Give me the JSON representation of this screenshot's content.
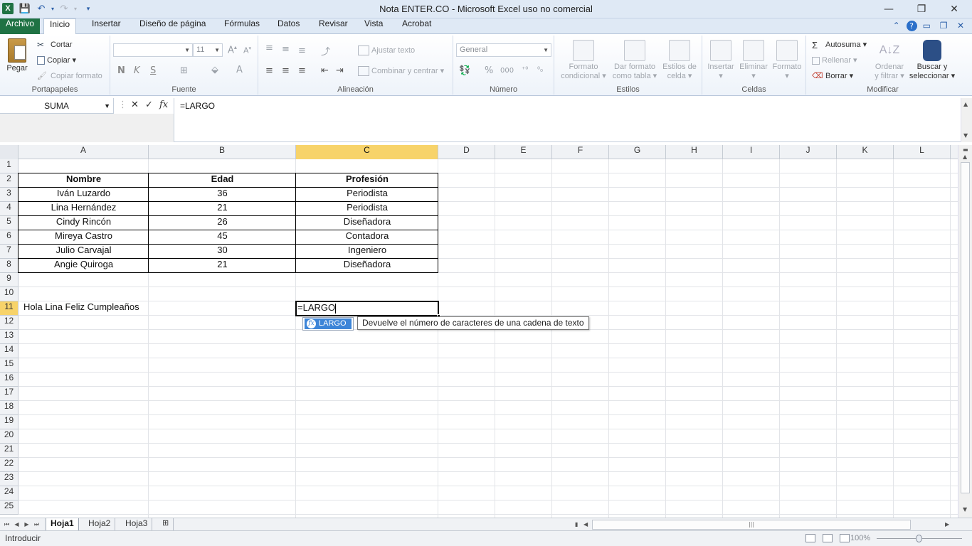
{
  "window": {
    "title": "Nota ENTER.CO  -  Microsoft Excel uso no comercial",
    "app_icon": "X",
    "minimize": "—",
    "restore": "❐",
    "close": "✕"
  },
  "qat": {
    "save": "💾",
    "undo": "↶",
    "redo": "↷",
    "customize": "▾"
  },
  "tabs": [
    "Archivo",
    "Inicio",
    "Insertar",
    "Diseño de página",
    "Fórmulas",
    "Datos",
    "Revisar",
    "Vista",
    "Acrobat"
  ],
  "ribbon": {
    "portapapeles": {
      "label": "Portapapeles",
      "pegar": "Pegar",
      "cortar": "Cortar",
      "copiar": "Copiar",
      "copiar_formato": "Copiar formato"
    },
    "fuente": {
      "label": "Fuente",
      "font_size": "11",
      "bold": "N",
      "italic": "K",
      "underline": "S"
    },
    "alineacion": {
      "label": "Alineación",
      "ajustar": "Ajustar texto",
      "combinar": "Combinar y centrar"
    },
    "numero": {
      "label": "Número",
      "format": "General",
      "percent": "%",
      "thousands": "000"
    },
    "estilos": {
      "label": "Estilos",
      "formato_condicional": [
        "Formato",
        "condicional"
      ],
      "dar_formato": [
        "Dar formato",
        "como tabla"
      ],
      "estilos_celda": [
        "Estilos de",
        "celda"
      ]
    },
    "celdas": {
      "label": "Celdas",
      "insertar": "Insertar",
      "eliminar": "Eliminar",
      "formato": "Formato"
    },
    "modificar": {
      "label": "Modificar",
      "autosuma": "Autosuma",
      "rellenar": "Rellenar",
      "borrar": "Borrar",
      "ordenar": [
        "Ordenar",
        "y filtrar"
      ],
      "buscar": [
        "Buscar y",
        "seleccionar"
      ]
    }
  },
  "formula_bar": {
    "name_box": "SUMA",
    "cancel": "✕",
    "enter": "✓",
    "fx": "fx",
    "formula": "=LARGO"
  },
  "columns": [
    "A",
    "B",
    "C",
    "D",
    "E",
    "F",
    "G",
    "H",
    "I",
    "J",
    "K",
    "L"
  ],
  "rows": [
    "1",
    "2",
    "3",
    "4",
    "5",
    "6",
    "7",
    "8",
    "9",
    "10",
    "11",
    "12",
    "13",
    "14",
    "15",
    "16",
    "17",
    "18",
    "19",
    "20",
    "21",
    "22",
    "23",
    "24",
    "25"
  ],
  "table": {
    "headers": [
      "Nombre",
      "Edad",
      "Profesión"
    ],
    "rows": [
      [
        "Iván Luzardo",
        "36",
        "Periodista"
      ],
      [
        "Lina Hernández",
        "21",
        "Periodista"
      ],
      [
        "Cindy Rincón",
        "26",
        "Diseñadora"
      ],
      [
        "Mireya Castro",
        "45",
        "Contadora"
      ],
      [
        "Julio Carvajal",
        "30",
        "Ingeniero"
      ],
      [
        "Angie Quiroga",
        "21",
        "Diseñadora"
      ]
    ]
  },
  "cells": {
    "A11": "Hola Lina Feliz Cumpleaños",
    "C11": "=LARGO"
  },
  "autocomplete": {
    "item": "LARGO",
    "tooltip": "Devuelve el número de caracteres de una cadena de texto"
  },
  "sheets": [
    "Hoja1",
    "Hoja2",
    "Hoja3"
  ],
  "status": {
    "mode": "Introducir",
    "zoom": "100%",
    "zoom_level_percent": 100
  },
  "colors": {
    "accent": "#1f7244",
    "selection_header": "#f7d36a",
    "autocomplete_highlight": "#3d85d8"
  }
}
